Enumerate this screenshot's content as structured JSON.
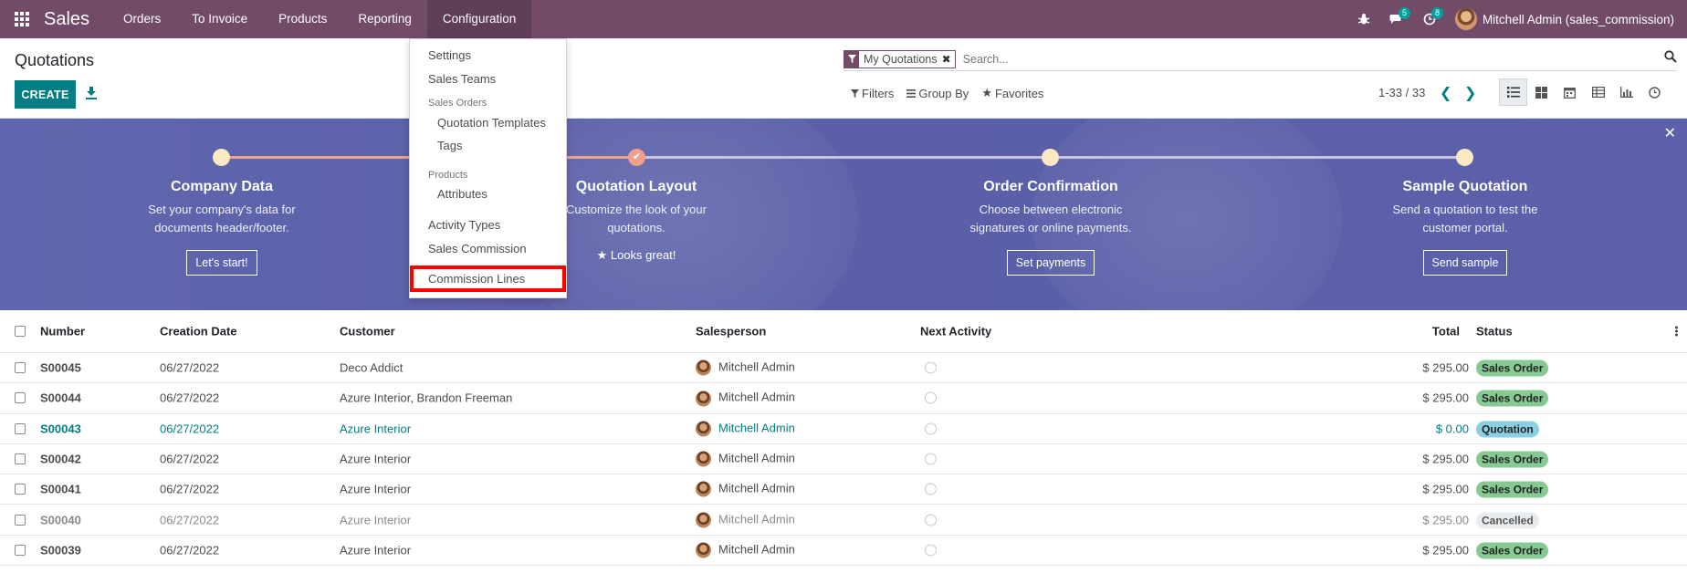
{
  "navbar": {
    "app_name": "Sales",
    "menu": [
      "Orders",
      "To Invoice",
      "Products",
      "Reporting",
      "Configuration"
    ],
    "active_menu": "Configuration",
    "chat_badge": "5",
    "activity_badge": "8",
    "user": "Mitchell Admin (sales_commission)",
    "bg_color": "#714b67"
  },
  "control": {
    "title": "Quotations",
    "create_label": "CREATE",
    "facet_label": "My Quotations",
    "search_placeholder": "Search...",
    "filters_label": "Filters",
    "groupby_label": "Group By",
    "favorites_label": "Favorites",
    "pager": "1-33 / 33"
  },
  "dropdown": {
    "settings": "Settings",
    "sales_teams": "Sales Teams",
    "header_sales_orders": "Sales Orders",
    "quotation_templates": "Quotation Templates",
    "tags": "Tags",
    "header_products": "Products",
    "attributes": "Attributes",
    "activity_types": "Activity Types",
    "sales_commission": "Sales Commission",
    "commission_lines": "Commission Lines"
  },
  "banner": {
    "steps": [
      {
        "title": "Company Data",
        "desc1": "Set your company's data for",
        "desc2": "documents header/footer.",
        "button": "Let's start!"
      },
      {
        "title": "Quotation Layout",
        "desc1": "Customize the look of your",
        "desc2": "quotations.",
        "done": "Looks great!"
      },
      {
        "title": "Order Confirmation",
        "desc1": "Choose between electronic",
        "desc2": "signatures or online payments.",
        "button": "Set payments"
      },
      {
        "title": "Sample Quotation",
        "desc1": "Send a quotation to test the",
        "desc2": "customer portal.",
        "button": "Send sample"
      }
    ]
  },
  "table": {
    "headers": {
      "number": "Number",
      "date": "Creation Date",
      "customer": "Customer",
      "salesperson": "Salesperson",
      "activity": "Next Activity",
      "total": "Total",
      "status": "Status"
    },
    "rows": [
      {
        "number": "S00045",
        "date": "06/27/2022",
        "customer": "Deco Addict",
        "salesperson": "Mitchell Admin",
        "total": "$ 295.00",
        "status": "Sales Order"
      },
      {
        "number": "S00044",
        "date": "06/27/2022",
        "customer": "Azure Interior, Brandon Freeman",
        "salesperson": "Mitchell Admin",
        "total": "$ 295.00",
        "status": "Sales Order"
      },
      {
        "number": "S00043",
        "date": "06/27/2022",
        "customer": "Azure Interior",
        "salesperson": "Mitchell Admin",
        "total": "$ 0.00",
        "status": "Quotation"
      },
      {
        "number": "S00042",
        "date": "06/27/2022",
        "customer": "Azure Interior",
        "salesperson": "Mitchell Admin",
        "total": "$ 295.00",
        "status": "Sales Order"
      },
      {
        "number": "S00041",
        "date": "06/27/2022",
        "customer": "Azure Interior",
        "salesperson": "Mitchell Admin",
        "total": "$ 295.00",
        "status": "Sales Order"
      },
      {
        "number": "S00040",
        "date": "06/27/2022",
        "customer": "Azure Interior",
        "salesperson": "Mitchell Admin",
        "total": "$ 295.00",
        "status": "Cancelled"
      },
      {
        "number": "S00039",
        "date": "06/27/2022",
        "customer": "Azure Interior",
        "salesperson": "Mitchell Admin",
        "total": "$ 295.00",
        "status": "Sales Order"
      }
    ]
  },
  "colors": {
    "primary": "#017e84",
    "sales_order_badge": "#86c993",
    "quotation_badge": "#8ccfe3",
    "cancelled_badge": "#e9ecef",
    "highlight": "#ff0000"
  }
}
